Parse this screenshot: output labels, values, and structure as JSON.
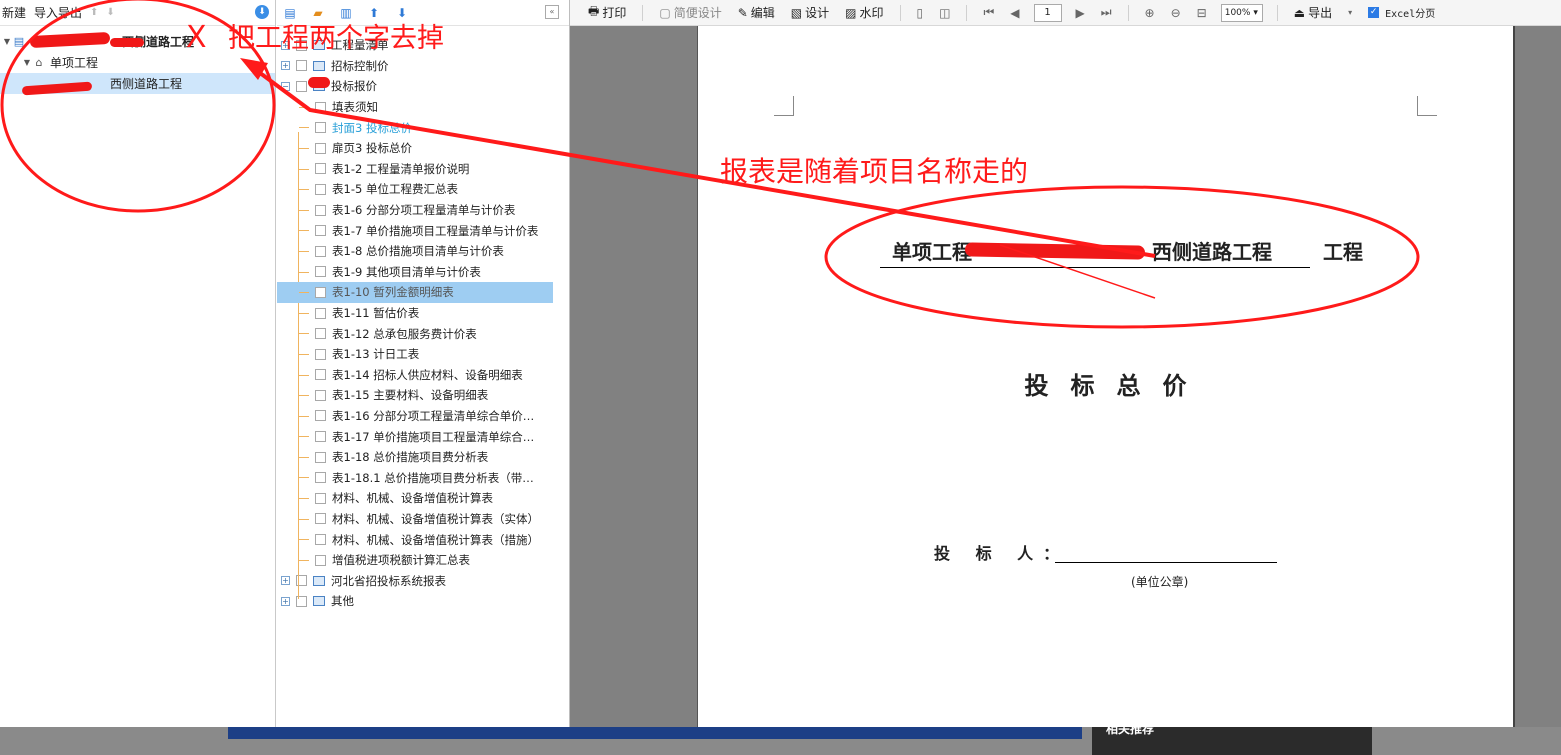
{
  "project_panel": {
    "toolbar": {
      "new": "新建",
      "import_export": "导入导出"
    },
    "tree": [
      {
        "label": "西侧道路工程",
        "level": 0,
        "selected": false
      },
      {
        "label": "单项工程",
        "level": 1,
        "selected": false
      },
      {
        "label": "西侧道路工程",
        "level": 2,
        "selected": true
      }
    ]
  },
  "report_panel": {
    "groups": [
      {
        "label": "工程量清单"
      },
      {
        "label": "招标控制价"
      },
      {
        "label": "投标报价"
      }
    ],
    "items": [
      {
        "label": "填表须知",
        "state": ""
      },
      {
        "label": "封面3 投标总价",
        "state": "link"
      },
      {
        "label": "扉页3 投标总价",
        "state": ""
      },
      {
        "label": "表1-2 工程量清单报价说明",
        "state": ""
      },
      {
        "label": "表1-5 单位工程费汇总表",
        "state": ""
      },
      {
        "label": "表1-6 分部分项工程量清单与计价表",
        "state": ""
      },
      {
        "label": "表1-7 单价措施项目工程量清单与计价表",
        "state": ""
      },
      {
        "label": "表1-8 总价措施项目清单与计价表",
        "state": ""
      },
      {
        "label": "表1-9 其他项目清单与计价表",
        "state": ""
      },
      {
        "label": "表1-10 暂列金额明细表",
        "state": "selected"
      },
      {
        "label": "表1-11 暂估价表",
        "state": ""
      },
      {
        "label": "表1-12 总承包服务费计价表",
        "state": ""
      },
      {
        "label": "表1-13 计日工表",
        "state": ""
      },
      {
        "label": "表1-14 招标人供应材料、设备明细表",
        "state": ""
      },
      {
        "label": "表1-15 主要材料、设备明细表",
        "state": ""
      },
      {
        "label": "表1-16 分部分项工程量清单综合单价…",
        "state": ""
      },
      {
        "label": "表1-17 单价措施项目工程量清单综合…",
        "state": ""
      },
      {
        "label": "表1-18 总价措施项目费分析表",
        "state": ""
      },
      {
        "label": "表1-18.1 总价措施项目费分析表（带…",
        "state": ""
      },
      {
        "label": "材料、机械、设备增值税计算表",
        "state": ""
      },
      {
        "label": "材料、机械、设备增值税计算表（实体）",
        "state": ""
      },
      {
        "label": "材料、机械、设备增值税计算表（措施）",
        "state": ""
      },
      {
        "label": "增值税进项税额计算汇总表",
        "state": ""
      }
    ],
    "bottom_groups": [
      {
        "label": "河北省招投标系统报表"
      },
      {
        "label": "其他"
      }
    ]
  },
  "preview_toolbar": {
    "print": "打印",
    "simple_design": "简便设计",
    "edit": "编辑",
    "design": "设计",
    "watermark": "水印",
    "page": "1",
    "zoom": "100%",
    "export": "导出",
    "excel_paging": "Excel分页"
  },
  "report_page": {
    "title_prefix": "单项工程",
    "title_project": "西侧道路工程",
    "title_suffix": "工程",
    "main_title": "投标总价",
    "bidder_label": "投 标 人：",
    "seal_note": "(单位公章)"
  },
  "annotations": {
    "remove_note": "把工程两个字去掉",
    "x_mark": "X",
    "report_note": "报表是随着项目名称走的"
  },
  "background": {
    "right_text": "相关推荐"
  },
  "colors": {
    "annotation_red": "#ff1a1a",
    "selection_blue": "#9ecdf2",
    "link_blue": "#2aa0d8"
  }
}
